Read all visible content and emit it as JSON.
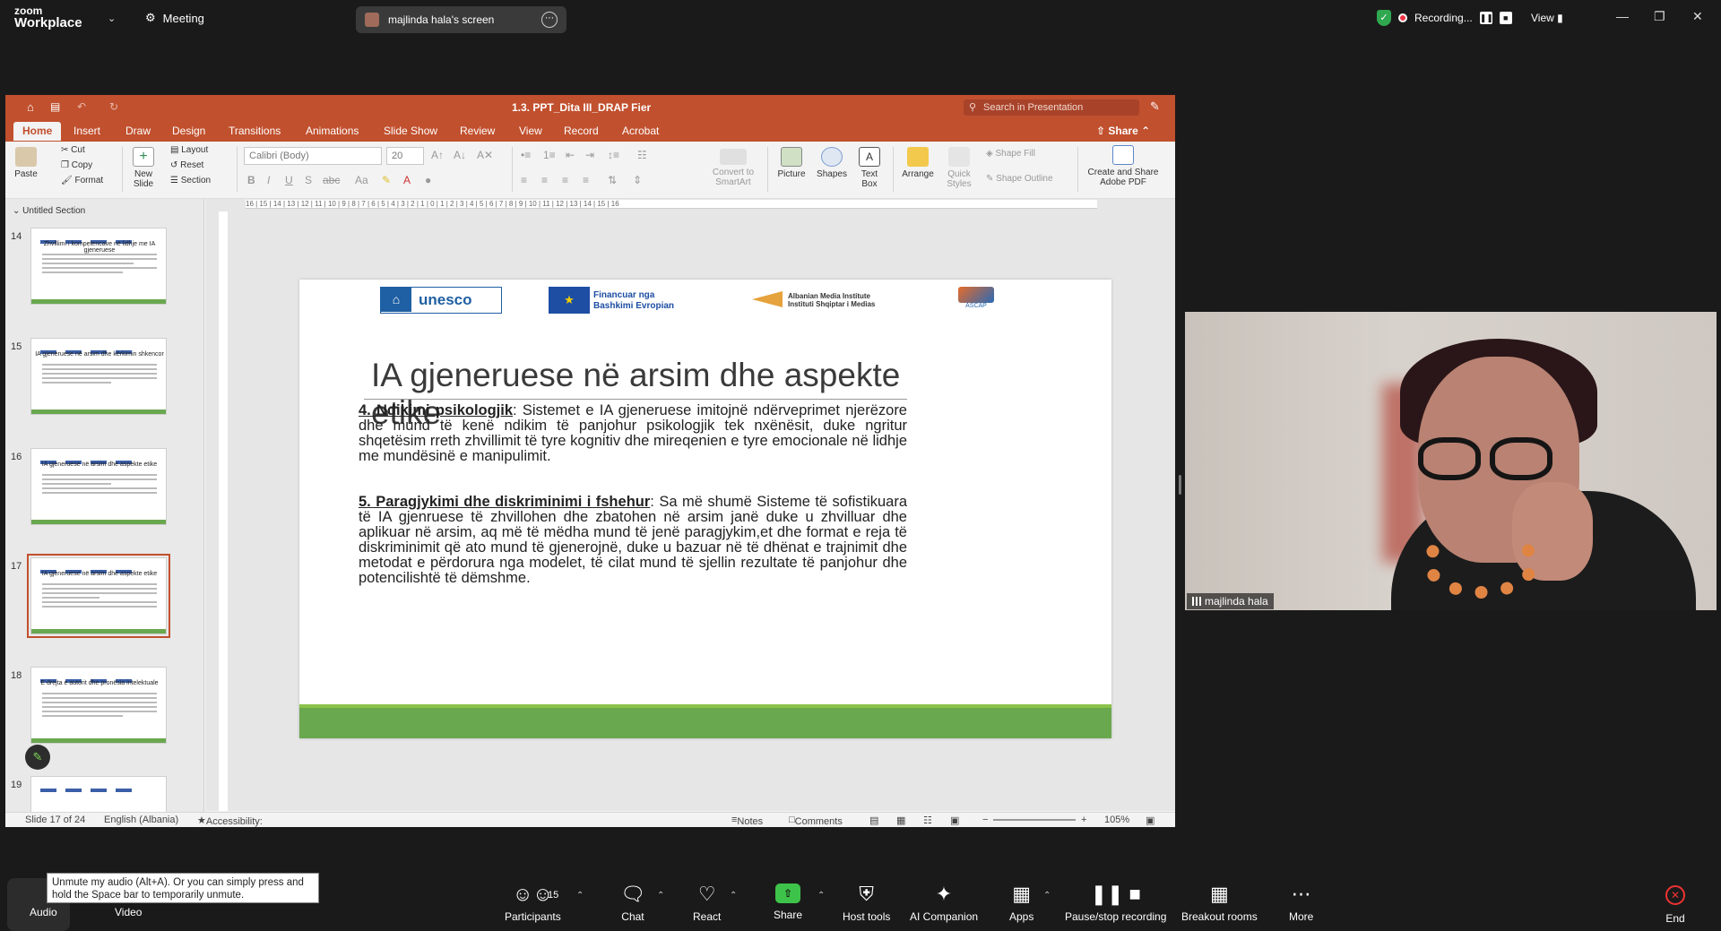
{
  "zoom": {
    "logo_line1": "zoom",
    "logo_line2": "Workplace",
    "meeting_label": "Meeting",
    "screen_label": "majlinda hala's screen",
    "recording_label": "Recording...",
    "view_label": "View"
  },
  "ppt": {
    "doc_title": "1.3. PPT_Dita III_DRAP Fier",
    "search_placeholder": "Search in Presentation",
    "share_label": "Share",
    "tabs": [
      "Home",
      "Insert",
      "Draw",
      "Design",
      "Transitions",
      "Animations",
      "Slide Show",
      "Review",
      "View",
      "Record",
      "Acrobat"
    ],
    "ribbon": {
      "paste": "Paste",
      "cut": "Cut",
      "copy": "Copy",
      "format": "Format",
      "new_slide": "New Slide",
      "layout": "Layout",
      "reset": "Reset",
      "section": "Section",
      "font_name": "Calibri (Body)",
      "font_size": "20",
      "convert_smartart": "Convert to SmartArt",
      "picture": "Picture",
      "shapes": "Shapes",
      "text_box": "Text Box",
      "arrange": "Arrange",
      "quick_styles": "Quick Styles",
      "shape_fill": "Shape Fill",
      "shape_outline": "Shape Outline",
      "create_share_pdf": "Create and Share Adobe PDF"
    },
    "section_label": "Untitled Section",
    "thumbnails": [
      {
        "num": "14",
        "title": "Zhvillimi i kompetencave në lidhje me IA gjeneruese"
      },
      {
        "num": "15",
        "title": "IA gjeneruese në arsim dhe kërkimin shkencor"
      },
      {
        "num": "16",
        "title": "IA gjeneruese në arsim dhe aspekte etike"
      },
      {
        "num": "17",
        "title": "IA gjeneruese në arsim dhe aspekte etike"
      },
      {
        "num": "18",
        "title": "E drejta e autorit dhe pronësia intelektuale"
      },
      {
        "num": "19",
        "title": ""
      }
    ],
    "ruler_text": "16 | 15 | 14 | 13 | 12 | 11 | 10 | 9 | 8 | 7 | 6 | 5 | 4 | 3 | 2 | 1 | 0 | 1 | 2 | 3 | 4 | 5 | 6 | 7 | 8 | 9 | 10 | 11 | 12 | 13 | 14 | 15 | 16",
    "slide": {
      "logo_unesco": "unesco",
      "logo_eu_line1": "Financuar nga",
      "logo_eu_line2": "Bashkimi Evropian",
      "logo_ami_line1": "Albanian Media Institute",
      "logo_ami_line2": "Instituti Shqiptar i Medias",
      "logo_ascap": "ASCAP",
      "title": "IA gjeneruese në arsim dhe aspekte etike",
      "p1_head": "4. Ndikimi psikologjik",
      "p1_body": ": Sistemet e IA gjeneruese  imitojnë ndërveprimet njerëzore dhe mund të kenë ndikim të panjohur psikologjik tek nxënësit, duke ngritur shqetësim rreth zhvillimit të tyre kognitiv dhe mireqenien e tyre emocionale në lidhje me mundësinë e manipulimit.",
      "p2_head": "5. Paragjykimi dhe diskriminimi i fshehur",
      "p2_body": ": Sa më shumë Sisteme të sofistikuara të IA gjenruese të zhvillohen dhe zbatohen në arsim janë duke u zhvilluar dhe aplikuar në arsim, aq më të mëdha mund të jenë  paragjykim,et dhe format e reja të diskriminimit që ato mund të gjenerojnë, duke u bazuar në të dhënat e trajnimit dhe metodat e përdorura nga modelet, të cilat mund të sjellin rezultate të panjohur dhe potencilishtë të dëmshme."
    },
    "status": {
      "slide_of": "Slide 17 of 24",
      "language": "English (Albania)",
      "accessibility": "Accessibility: Investigate",
      "notes": "Notes",
      "comments": "Comments",
      "zoom_pct": "105%"
    }
  },
  "video": {
    "participant_name": "majlinda hala"
  },
  "toolbar": {
    "audio": "Audio",
    "video": "Video",
    "participants": "Participants",
    "participants_count": "15",
    "chat": "Chat",
    "react": "React",
    "share": "Share",
    "host_tools": "Host tools",
    "ai_companion": "AI Companion",
    "apps": "Apps",
    "pause_recording": "Pause/stop recording",
    "breakout": "Breakout rooms",
    "more": "More",
    "end": "End",
    "tooltip": "Unmute my audio (Alt+A). Or you can simply press and hold the Space bar to temporarily unmute."
  },
  "colors": {
    "ppt_accent": "#c1502e",
    "share_green": "#3ec34a",
    "slide_green": "#6aa84f",
    "end_red": "#e33"
  }
}
